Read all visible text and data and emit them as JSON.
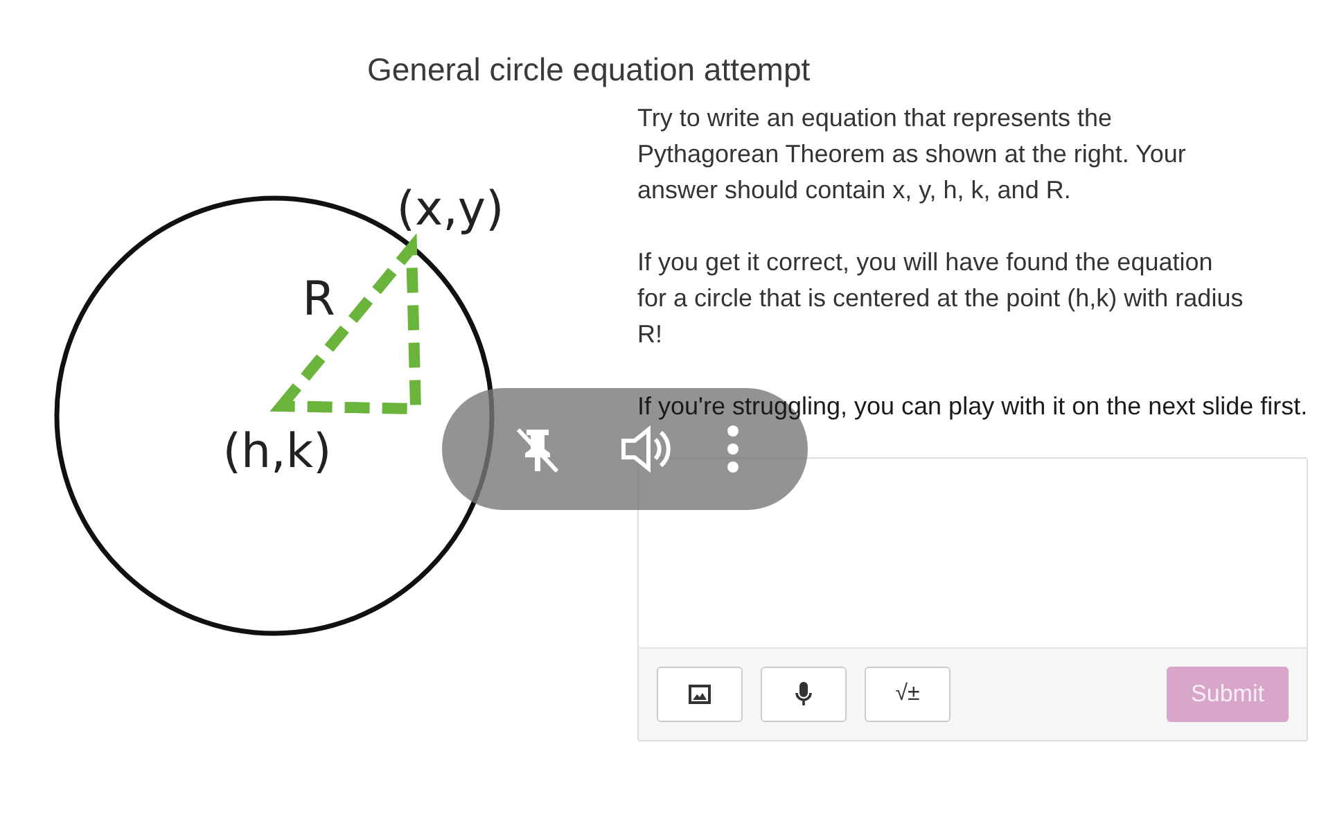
{
  "title": "General circle equation attempt",
  "diagram": {
    "labels": [
      {
        "kind": "point",
        "text": "(x,y)"
      },
      {
        "kind": "radius",
        "text": "R"
      },
      {
        "kind": "center",
        "text": "(h,k)"
      }
    ]
  },
  "paragraphs": [
    "Try to write an equation that represents the Pythagorean Theorem as shown at the right. Your answer should contain x, y, h, k, and R.",
    "If you get it correct, you will have found the equation for a circle that is centered at the point (h,k) with radius R!",
    "If you're struggling, you can play with it on the next slide first."
  ],
  "answer": {
    "tools": [
      {
        "kind": "image"
      },
      {
        "kind": "mic"
      },
      {
        "kind": "math",
        "text": "√±"
      }
    ],
    "submit": {
      "label": "Submit",
      "disabled": true
    }
  },
  "overlay": {
    "controls": [
      {
        "kind": "unpin"
      },
      {
        "kind": "volume"
      },
      {
        "kind": "more"
      }
    ]
  }
}
